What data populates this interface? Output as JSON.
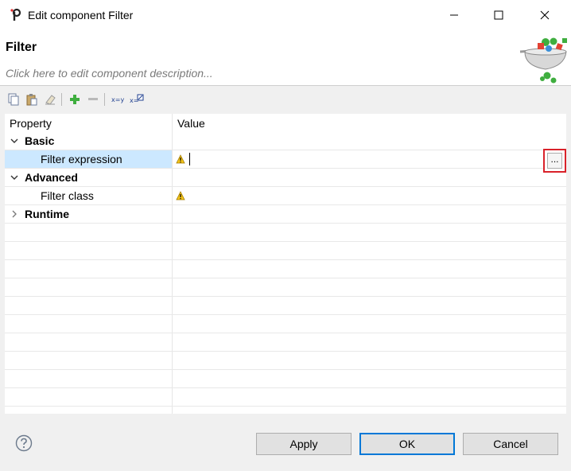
{
  "window": {
    "title": "Edit component Filter",
    "app_icon": "talend-icon",
    "controls": [
      "minimize-icon",
      "maximize-icon",
      "close-icon"
    ]
  },
  "header": {
    "component_name": "Filter",
    "description_placeholder": "Click here to edit component description..."
  },
  "toolbar": {
    "items": [
      "copy-icon",
      "paste-icon",
      "clear-icon",
      "add-icon",
      "remove-icon",
      "assign-icon",
      "expression-icon"
    ]
  },
  "grid": {
    "columns": {
      "property": "Property",
      "value": "Value"
    },
    "rows": [
      {
        "kind": "group",
        "label": "Basic",
        "expanded": true
      },
      {
        "kind": "property",
        "label": "Filter expression",
        "value": "",
        "warning": true,
        "selected": true
      },
      {
        "kind": "group",
        "label": "Advanced",
        "expanded": true
      },
      {
        "kind": "property",
        "label": "Filter class",
        "value": "",
        "warning": true
      },
      {
        "kind": "group",
        "label": "Runtime",
        "expanded": false
      }
    ],
    "edit_button_label": "..."
  },
  "footer": {
    "apply_label": "Apply",
    "ok_label": "OK",
    "cancel_label": "Cancel"
  },
  "colors": {
    "selection": "#cce8ff",
    "highlight_border": "#d9222a",
    "default_button_border": "#0078d7",
    "warning": "#f5c518"
  }
}
